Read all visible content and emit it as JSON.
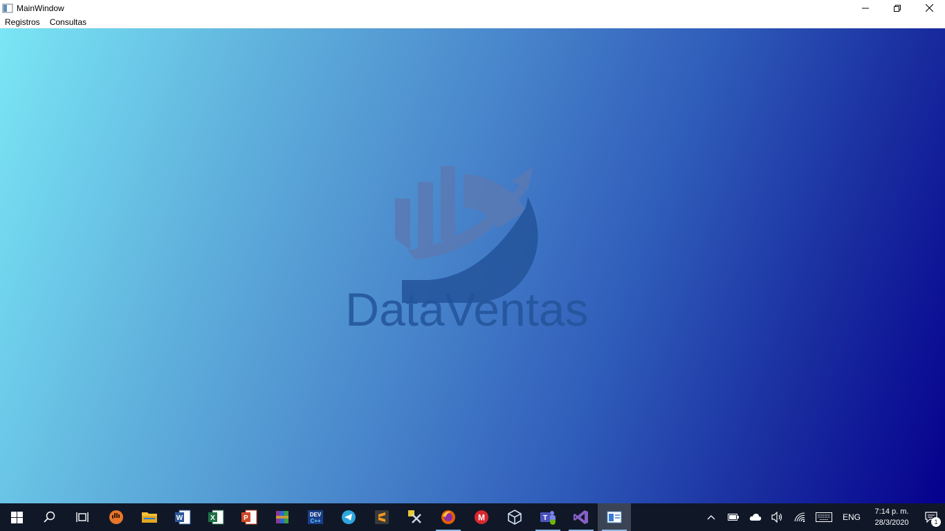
{
  "window": {
    "title": "MainWindow",
    "controls": {
      "minimize": "–",
      "restore": "❐",
      "close": "✕"
    }
  },
  "menu": {
    "items": [
      {
        "label": "Registros"
      },
      {
        "label": "Consultas"
      }
    ]
  },
  "main": {
    "logo_text": "DataVentas"
  },
  "taskbar": {
    "apps": [
      {
        "name": "start-icon"
      },
      {
        "name": "search-icon"
      },
      {
        "name": "task-view-icon"
      },
      {
        "name": "app-hand-icon"
      },
      {
        "name": "file-explorer-icon"
      },
      {
        "name": "word-icon"
      },
      {
        "name": "excel-icon"
      },
      {
        "name": "powerpoint-icon"
      },
      {
        "name": "winrar-icon"
      },
      {
        "name": "devcpp-icon"
      },
      {
        "name": "telegram-icon"
      },
      {
        "name": "sublime-icon"
      },
      {
        "name": "tool-icon"
      },
      {
        "name": "firefox-icon"
      },
      {
        "name": "mega-icon"
      },
      {
        "name": "virtualbox-icon"
      },
      {
        "name": "teams-icon"
      },
      {
        "name": "visual-studio-icon"
      },
      {
        "name": "main-window-app-icon"
      }
    ],
    "tray": {
      "language": "ENG",
      "time": "7:14 p. m.",
      "date": "28/3/2020",
      "notifications": "1"
    }
  },
  "colors": {
    "gradient_start": "#7ae6f5",
    "gradient_end": "#05008e",
    "logo": "#23549a",
    "taskbar": "#101828"
  }
}
